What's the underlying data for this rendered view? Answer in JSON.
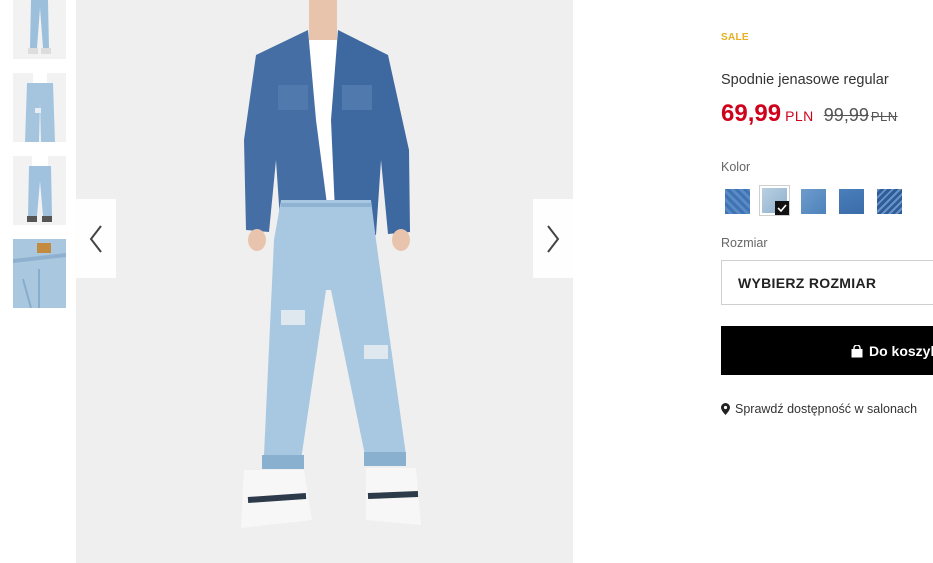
{
  "gallery": {
    "thumbnails": [
      {
        "icon": "jeans-front-thumbnail"
      },
      {
        "icon": "jeans-side-thumbnail"
      },
      {
        "icon": "jeans-back-thumbnail"
      },
      {
        "icon": "jeans-detail-thumbnail"
      }
    ],
    "main_image_icon": "model-wearing-jeans-photo",
    "prev_icon": "chevron-left-icon",
    "next_icon": "chevron-right-icon"
  },
  "product": {
    "badge": "SALE",
    "title": "Spodnie jenasowe regular",
    "price_new": "69,99",
    "price_new_currency": "PLN",
    "price_old": "99,99",
    "price_old_currency": "PLN"
  },
  "color": {
    "label": "Kolor",
    "swatches": [
      {
        "color": "#3f73b3",
        "selected": false
      },
      {
        "color": "#9bb9d2",
        "selected": true
      },
      {
        "color": "#5c8fc4",
        "selected": false
      },
      {
        "color": "#4177b4",
        "selected": false
      },
      {
        "color": "#2f5d9a",
        "selected": false
      }
    ]
  },
  "size": {
    "label": "Rozmiar",
    "select_value": "WYBIERZ ROZMIAR"
  },
  "cart": {
    "label": "Do koszyka",
    "icon": "shopping-bag-icon"
  },
  "store": {
    "label": "Sprawdź dostępność w salonach",
    "icon": "map-pin-icon"
  },
  "colors": {
    "sale": "#e6b021",
    "price": "#d0021b",
    "button": "#000000"
  }
}
